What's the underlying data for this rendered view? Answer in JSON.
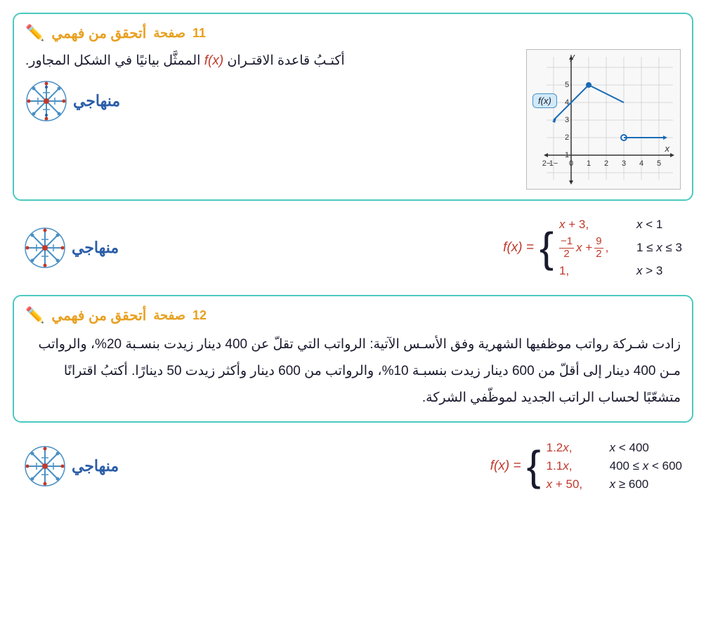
{
  "section1": {
    "header_title": "أتحقق من فهمي",
    "header_page_label": "صفحة",
    "header_page_num": "11",
    "question": "أكتـبُ قاعدة الاقتـران f(x) الممثَّل بيانيًا في الشكل المجاور."
  },
  "section2": {
    "fx_label": "f(x) =",
    "cases": [
      {
        "expr": "x + 3,",
        "cond": "x < 1"
      },
      {
        "expr": "−1/2 x + 9/2,",
        "cond": "1 ≤ x ≤ 3"
      },
      {
        "expr": "1,",
        "cond": "x > 3"
      }
    ]
  },
  "section3": {
    "header_title": "أتحقق من فهمي",
    "header_page_label": "صفحة",
    "header_page_num": "12",
    "paragraph": "زادت شـركة رواتب موظفيها الشهرية وفق الأسـس الآتية: الرواتب التي تقلّ عن 400 دينار زيدت بنسـبة 20%، والرواتب مـن 400 دينار إلى أقلّ من 600 دينار زيدت بنسبـة 10%، والرواتب من 600 دينار وأكثر زيدت 50 دينارًا. أكتبُ اقترانًا متشعّبًا لحساب الراتب الجديد لموظّفي الشركة."
  },
  "section4": {
    "fx_label": "f(x) =",
    "cases": [
      {
        "expr": "1.2x,",
        "cond": "x < 400"
      },
      {
        "expr": "1.1x,",
        "cond": "400 ≤ x < 600"
      },
      {
        "expr": "x + 50,",
        "cond": "x ≥ 600"
      }
    ]
  },
  "logo": {
    "text": "منهاجي"
  },
  "graph": {
    "fx_box": "f(x)"
  }
}
